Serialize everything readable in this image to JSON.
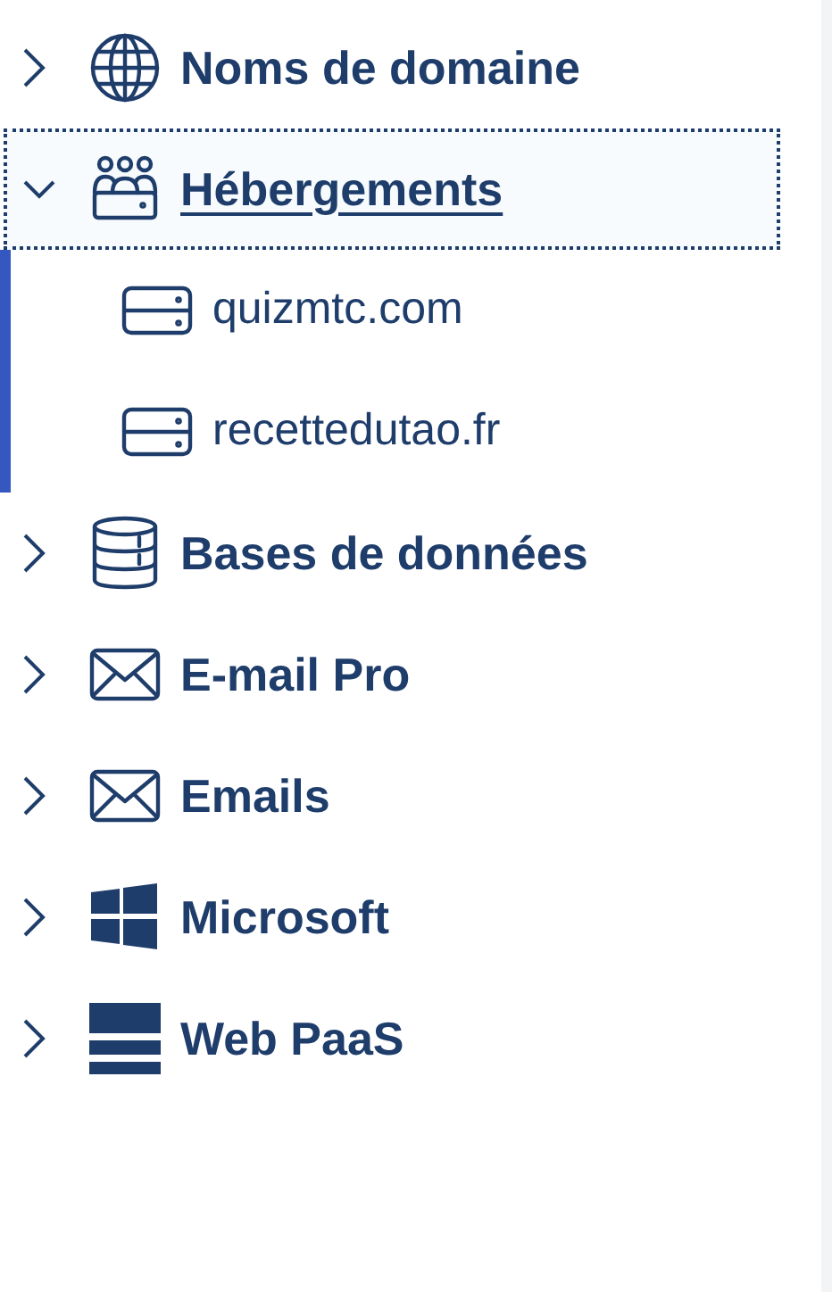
{
  "menu": [
    {
      "label": "Noms de domaine",
      "kind": "globe",
      "expanded": false,
      "focused": false
    },
    {
      "label": "Hébergements",
      "kind": "hosting",
      "expanded": true,
      "focused": true,
      "children": [
        {
          "label": "quizmtc.com",
          "kind": "server"
        },
        {
          "label": "recettedutao.fr",
          "kind": "server"
        }
      ]
    },
    {
      "label": "Bases de données",
      "kind": "database",
      "expanded": false,
      "focused": false
    },
    {
      "label": "E-mail Pro",
      "kind": "mail",
      "expanded": false,
      "focused": false
    },
    {
      "label": "Emails",
      "kind": "mail",
      "expanded": false,
      "focused": false
    },
    {
      "label": "Microsoft",
      "kind": "windows",
      "expanded": false,
      "focused": false
    },
    {
      "label": "Web PaaS",
      "kind": "stack",
      "expanded": false,
      "focused": false
    }
  ]
}
